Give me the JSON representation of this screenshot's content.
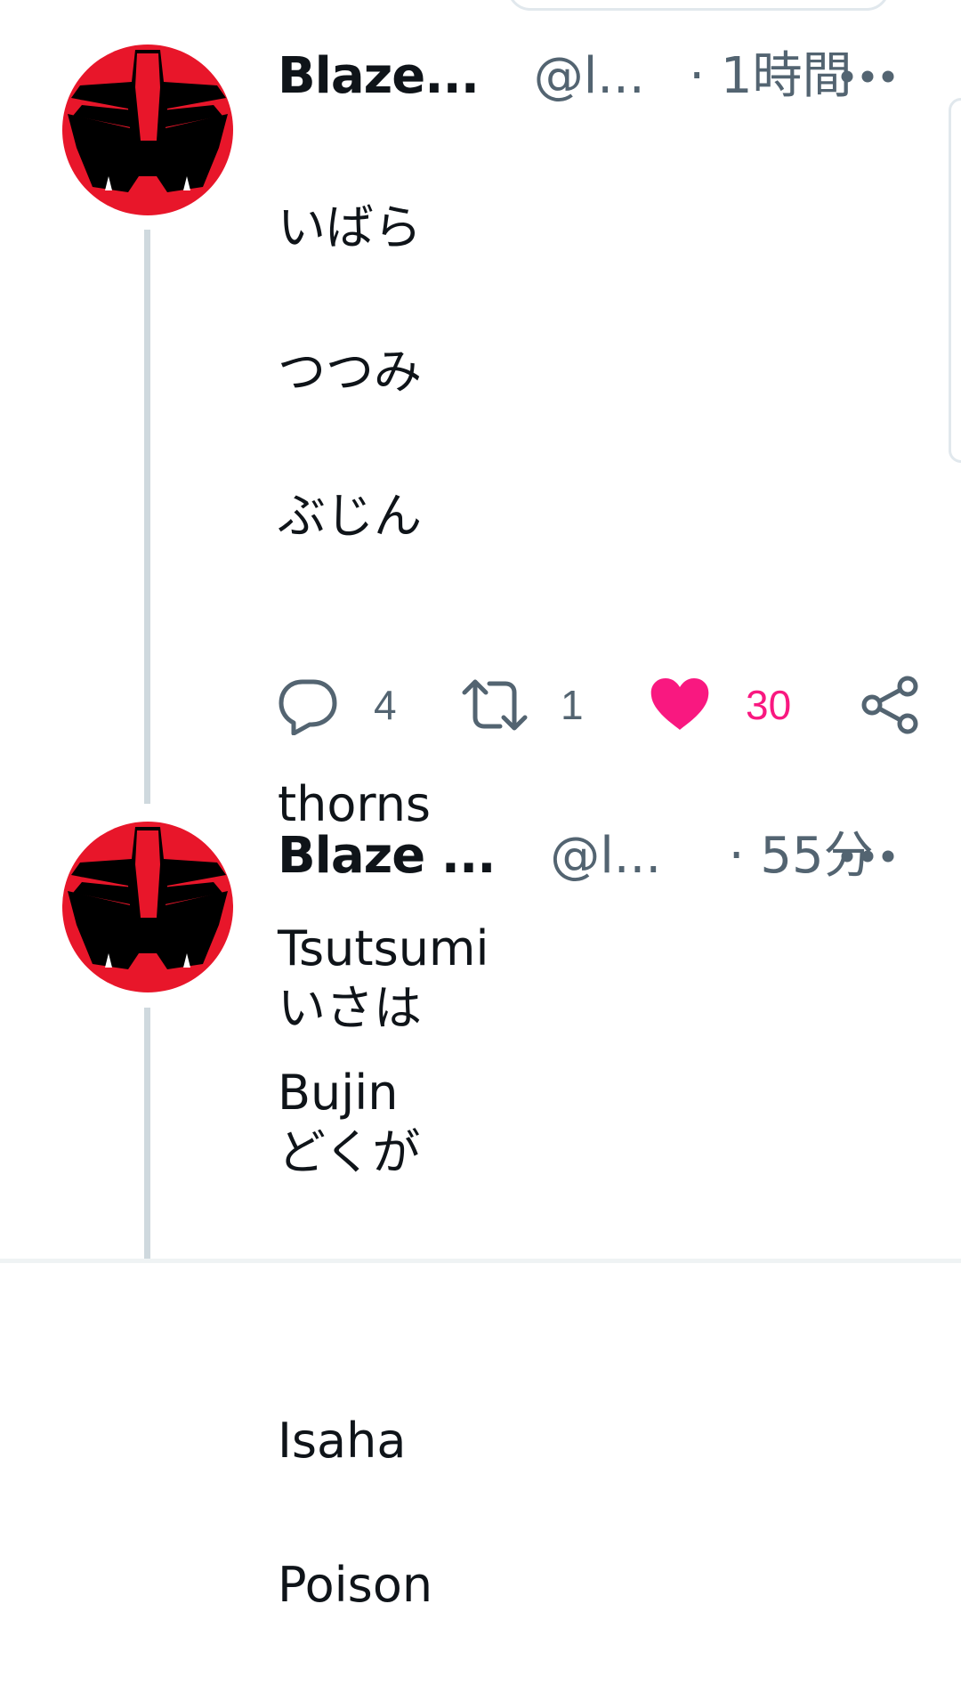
{
  "tweets": [
    {
      "name": "Blaze...",
      "handle": "@l...",
      "time": "· 1時間",
      "lines": [
        "いばら",
        "つつみ",
        "ぶじん",
        "",
        "thorns",
        "Tsutsumi",
        "Bujin"
      ],
      "actions": {
        "replies": "4",
        "retweets": "1",
        "likes": "30"
      }
    },
    {
      "name": "Blaze ...",
      "handle": "@l...",
      "time": "· 55分",
      "lines": [
        "いさは",
        "どくが",
        "",
        "Isaha",
        "Poison"
      ]
    }
  ],
  "icons": {
    "more": "more-horizontal-icon",
    "reply": "reply-bubble-icon",
    "retweet": "retweet-icon",
    "like": "heart-icon",
    "share": "share-icon",
    "avatar": "avatar-mask-icon"
  },
  "colors": {
    "like_active": "#f91880",
    "secondary_text": "#536471",
    "primary_text": "#0f1419",
    "thread_line": "#cfd9de",
    "avatar_red": "#e8162a"
  }
}
